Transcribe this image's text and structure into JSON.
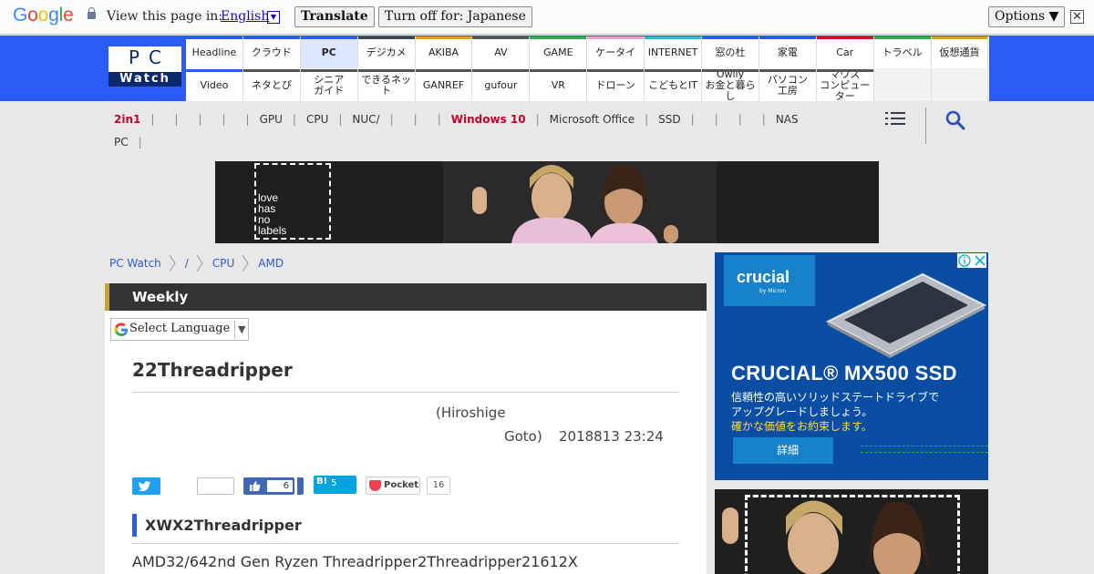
{
  "translate_bar": {
    "logo": "Google",
    "view_text": "View this page in:",
    "language": "English",
    "translate_label": "Translate",
    "turn_off_label": "Turn off for: Japanese",
    "options_label": "Options ▼",
    "close_glyph": "✕"
  },
  "logo": {
    "top": "PC",
    "bottom": "Watch"
  },
  "nav": {
    "row1": [
      {
        "label": "Headline",
        "color": "#2a5cf5"
      },
      {
        "label": "クラウド",
        "color": "#2a5cf5"
      },
      {
        "label": "PC",
        "color": "#2a5cf5",
        "selected": true
      },
      {
        "label": "デジカメ",
        "color": "#37474f"
      },
      {
        "label": "AKIBA",
        "color": "#e59a1e"
      },
      {
        "label": "AV",
        "color": "#555555"
      },
      {
        "label": "GAME",
        "color": "#2eaa4f"
      },
      {
        "label": "ケータイ",
        "color": "#e9a5c6"
      },
      {
        "label": "INTERNET",
        "color": "#35b7c8"
      },
      {
        "label": "窓の杜",
        "color": "#2a5cf5"
      },
      {
        "label": "家電",
        "color": "#2a5cf5"
      },
      {
        "label": "Car",
        "color": "#c8102e"
      },
      {
        "label": "トラベル",
        "color": "#2eaa4f"
      },
      {
        "label": "仮想通貨",
        "color": "#d4a020"
      }
    ],
    "row2": [
      {
        "label": "Video",
        "color": "#2a5cf5"
      },
      {
        "label": "ネタとぴ",
        "color": "#555555"
      },
      {
        "label": "シニア\nガイド",
        "color": "#555555"
      },
      {
        "label": "できるネット",
        "color": "#555555"
      },
      {
        "label": "GANREF",
        "color": "#555555"
      },
      {
        "label": "gufour",
        "color": "#555555"
      },
      {
        "label": "VR",
        "color": "#555555"
      },
      {
        "label": "ドローン",
        "color": "#555555"
      },
      {
        "label": "こどもとIT",
        "color": "#555555"
      },
      {
        "label": "Owlly\nお金と暮らし",
        "color": "#555555"
      },
      {
        "label": "パソコン\n工房",
        "color": "#555555"
      },
      {
        "label": "マウス\nコンピューター",
        "color": "#555555"
      }
    ]
  },
  "subnav": {
    "items": [
      "2in1",
      "",
      "",
      "",
      "",
      "GPU",
      "CPU",
      "NUC/",
      "",
      "",
      "Windows 10",
      "Microsoft Office",
      "SSD",
      "",
      "",
      "",
      "NAS"
    ],
    "highlight": [
      "2in1",
      "Windows 10"
    ],
    "row2": "PC"
  },
  "banner": {
    "text": "love\nhas\nno\nlabels"
  },
  "breadcrumb": [
    "PC Watch",
    "/",
    "CPU",
    "AMD"
  ],
  "article": {
    "section_label": "Weekly",
    "select_language": "Select Language",
    "title": "22Threadripper",
    "author_line1": "(Hiroshige",
    "author_line2": "Goto)",
    "date": "2018813 23:24",
    "social": {
      "like_count": "6",
      "hatena_label": "B!",
      "hatena_count": "5",
      "pocket_label": "Pocket",
      "pocket_count": "16"
    },
    "heading": "XWX2Threadripper",
    "body": "AMD32/642nd Gen Ryzen Threadripper2Threadripper21612X"
  },
  "ad_right": {
    "brand": "crucial",
    "brand_sub": "by Micron",
    "title": "CRUCIAL® MX500 SSD",
    "line1": "信頼性の高いソリッドステートドライブで",
    "line2": "アップグレードしましょう。",
    "line3": "確かな価値をお約束します。",
    "button": "詳細",
    "ssd_label": "crucial"
  }
}
